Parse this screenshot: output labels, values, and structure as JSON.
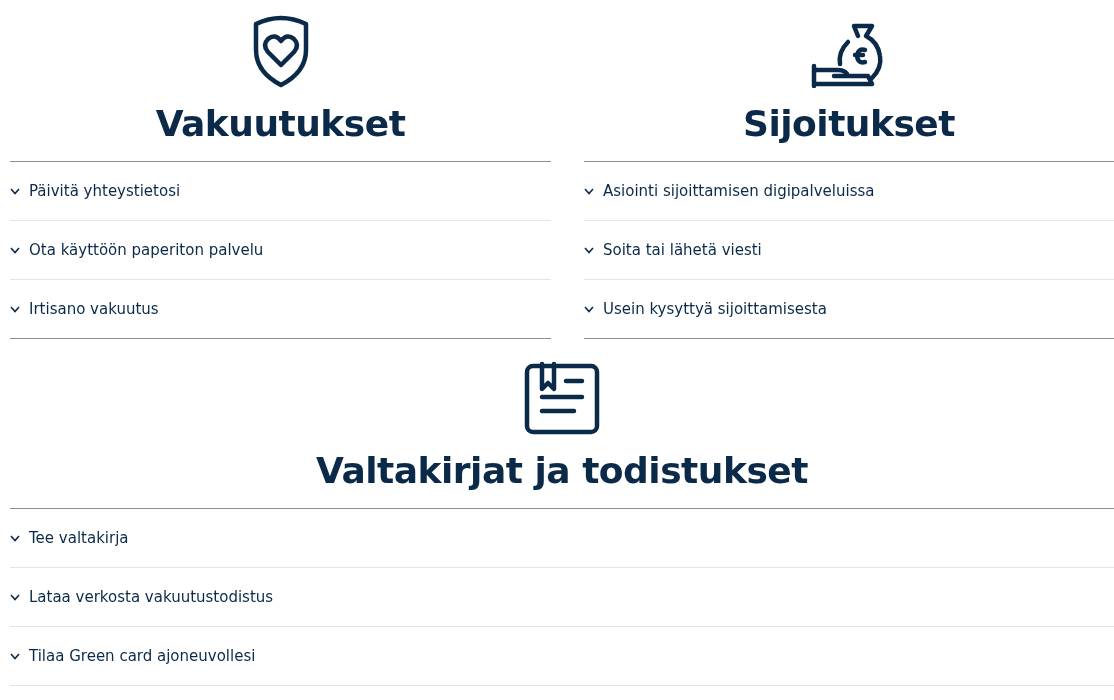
{
  "sections": [
    {
      "kind": "shield",
      "title": "Vakuutukset",
      "items": [
        {
          "label": "Päivitä yhteystietosi",
          "expanded": false
        },
        {
          "label": "Ota käyttöön paperiton palvelu",
          "expanded": false
        },
        {
          "label": "Irtisano vakuutus",
          "expanded": false
        }
      ]
    },
    {
      "kind": "moneybag",
      "title": "Sijoitukset",
      "items": [
        {
          "label": "Asiointi sijoittamisen digipalveluissa",
          "expanded": false
        },
        {
          "label": "Soita tai lähetä viesti",
          "expanded": false
        },
        {
          "label": "Usein kysyttyä sijoittamisesta",
          "expanded": false
        }
      ]
    },
    {
      "kind": "document",
      "title": "Valtakirjat ja todistukset",
      "items": [
        {
          "label": "Tee valtakirja",
          "expanded": false
        },
        {
          "label": "Lataa verkosta vakuutustodistus",
          "expanded": false
        },
        {
          "label": "Tilaa Green card ajoneuvollesi",
          "expanded": false
        }
      ]
    }
  ]
}
